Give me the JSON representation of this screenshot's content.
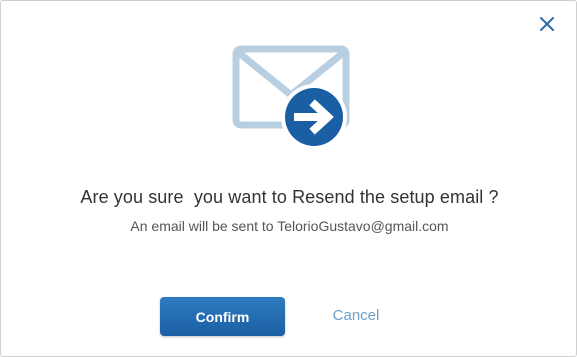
{
  "dialog": {
    "title": "Are you sure  you want to Resend the setup email ?",
    "message": "An email will be sent to TelorioGustavo@gmail.com",
    "confirm_label": "Confirm",
    "cancel_label": "Cancel",
    "icons": {
      "close": "close-icon",
      "hero": "envelope-arrow-icon"
    },
    "colors": {
      "primary": "#1a5fa3",
      "envelope": "#b8cfe2",
      "link": "#6a9fc9",
      "close": "#2a6aa8"
    }
  }
}
